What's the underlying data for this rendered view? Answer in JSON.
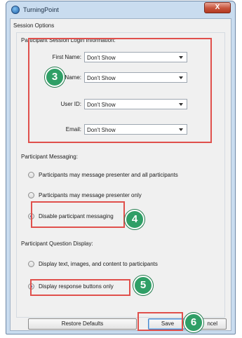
{
  "window": {
    "title": "TurningPoint",
    "close_glyph": "X"
  },
  "session_options": {
    "group_label": "Session Options",
    "login_section": {
      "label": "Participant Session Login Information:",
      "fields": [
        {
          "label": "First Name:",
          "value": "Don't Show"
        },
        {
          "label": "st Name:",
          "value": "Don't Show"
        },
        {
          "label": "User ID:",
          "value": "Don't Show"
        },
        {
          "label": "Email:",
          "value": "Don't Show"
        }
      ]
    },
    "messaging": {
      "label": "Participant Messaging:",
      "options": [
        {
          "label": "Participants may message presenter and all participants",
          "checked": false
        },
        {
          "label": "Participants may message presenter only",
          "checked": false
        },
        {
          "label": "Disable participant messaging",
          "checked": true
        }
      ]
    },
    "question_display": {
      "label": "Participant Question Display:",
      "options": [
        {
          "label": "Display text, images, and content to participants",
          "checked": false
        },
        {
          "label": "Display response buttons only",
          "checked": true
        }
      ]
    }
  },
  "buttons": {
    "restore": "Restore Defaults",
    "save": "Save",
    "cancel": "ncel"
  },
  "callouts": [
    "3",
    "4",
    "5",
    "6"
  ],
  "colors": {
    "highlight": "#e0504c",
    "badge": "#2f9f66"
  }
}
